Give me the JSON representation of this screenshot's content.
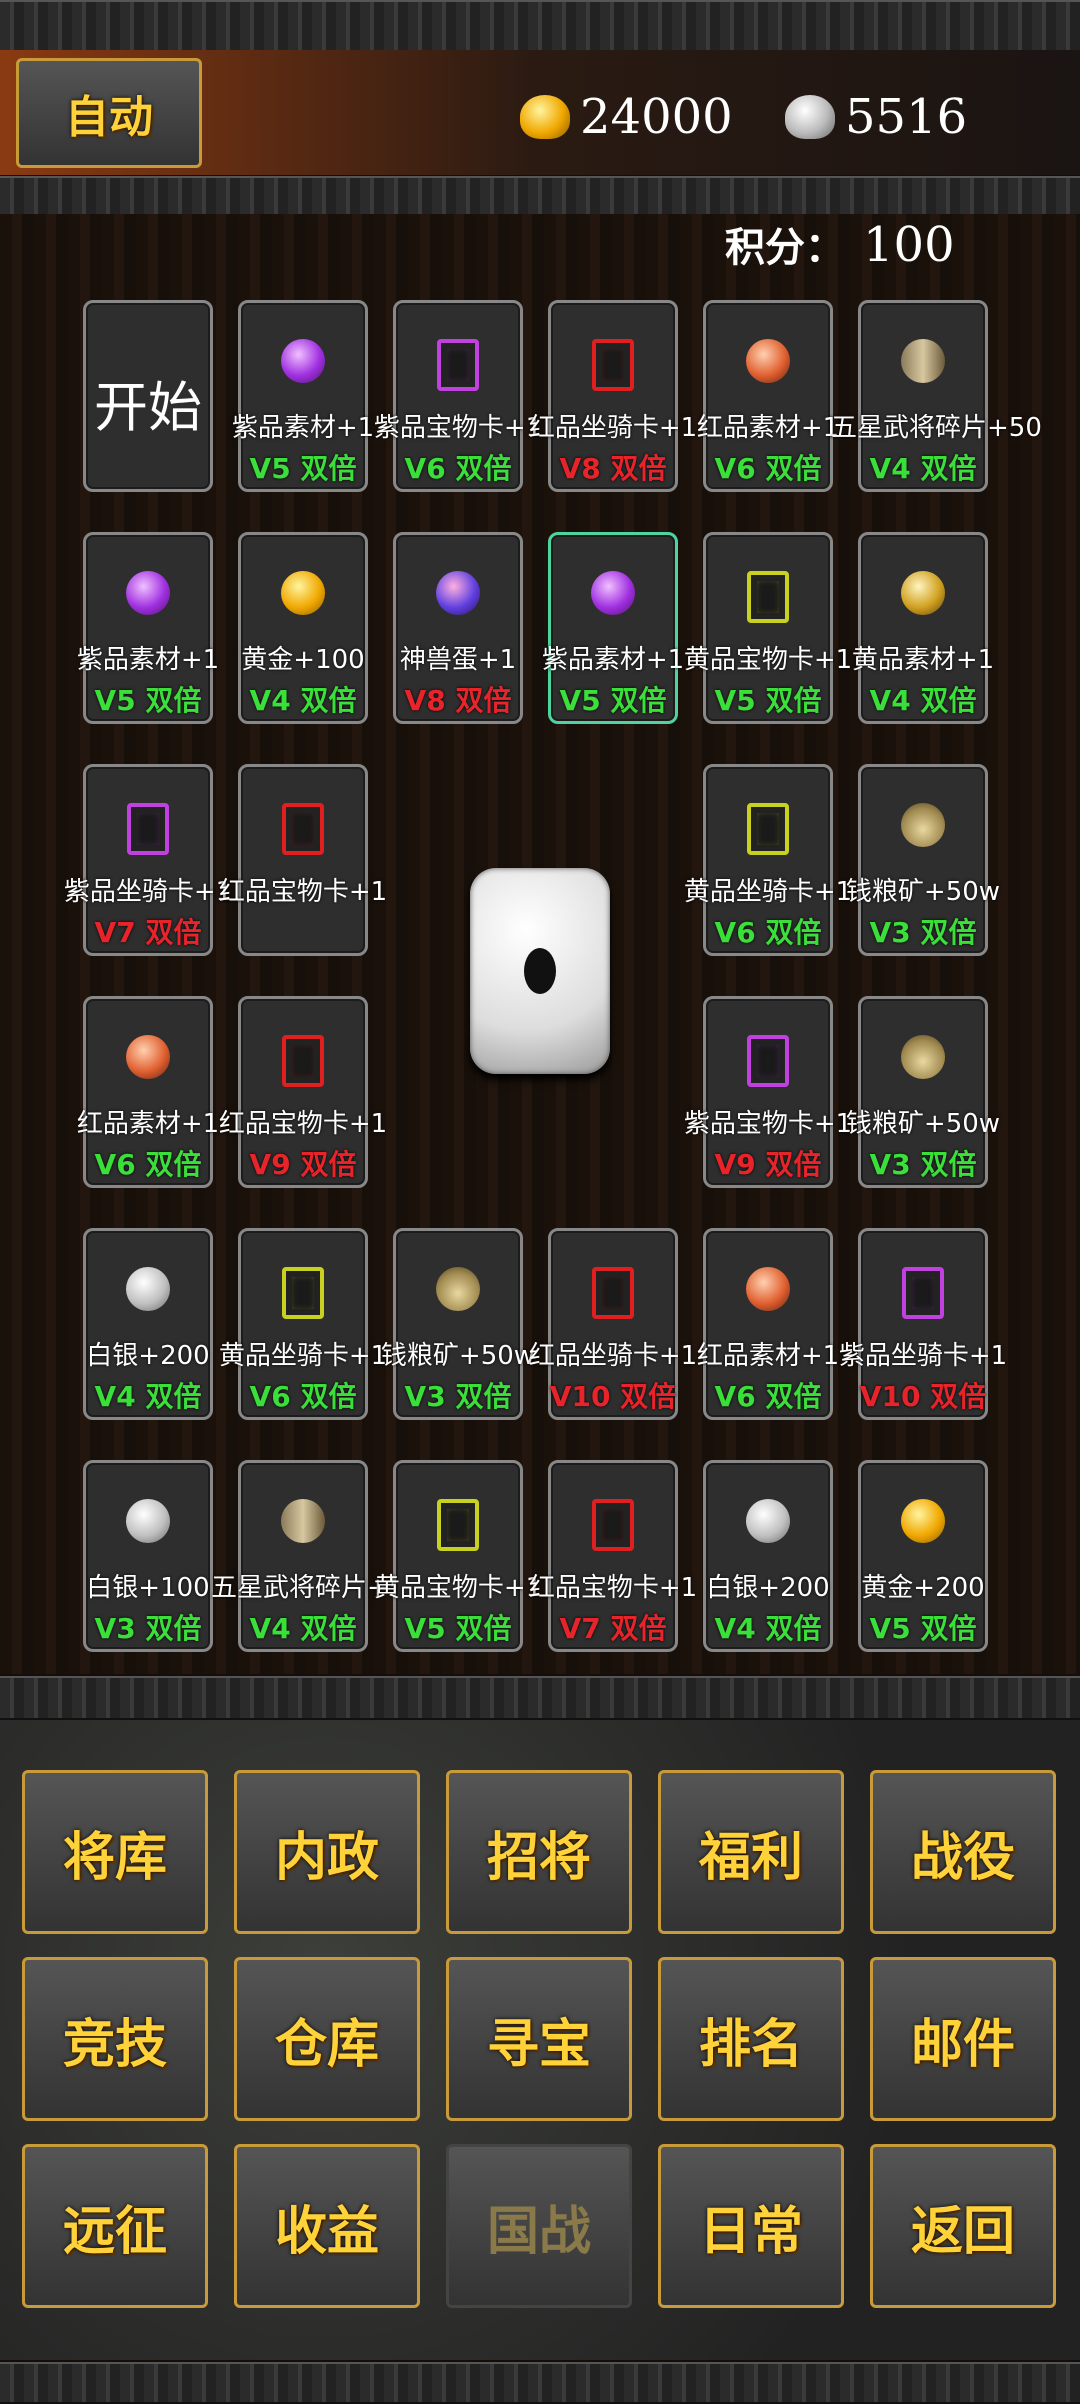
{
  "topbar": {
    "auto_label": "自动",
    "gold": "24000",
    "silver": "5516"
  },
  "score": {
    "label": "积分：",
    "value": "100"
  },
  "start_label": "开始",
  "colors": {
    "green": "#3adf3a",
    "red": "#e8242a",
    "gold_text": "#ffd23a",
    "selected_border": "#4fd3a0"
  },
  "tiles": [
    {
      "name": "紫品素材+1",
      "bonus": "V5 双倍",
      "bonus_color": "green",
      "icon": "purple-material-icon"
    },
    {
      "name": "紫品宝物卡+1",
      "bonus": "V6 双倍",
      "bonus_color": "green",
      "icon": "purple-treasure-card-icon"
    },
    {
      "name": "红品坐骑卡+1",
      "bonus": "V8 双倍",
      "bonus_color": "red",
      "icon": "red-mount-card-icon"
    },
    {
      "name": "红品素材+1",
      "bonus": "V6 双倍",
      "bonus_color": "green",
      "icon": "red-material-icon"
    },
    {
      "name": "五星武将碎片+50",
      "bonus": "V4 双倍",
      "bonus_color": "green",
      "icon": "general-fragment-icon"
    },
    {
      "name": "紫品素材+1",
      "bonus": "V5 双倍",
      "bonus_color": "green",
      "icon": "purple-material-icon"
    },
    {
      "name": "黄金+100",
      "bonus": "V4 双倍",
      "bonus_color": "green",
      "icon": "gold-ingot-icon"
    },
    {
      "name": "神兽蛋+1",
      "bonus": "V8 双倍",
      "bonus_color": "red",
      "icon": "beast-egg-icon"
    },
    {
      "name": "紫品素材+1",
      "bonus": "V5 双倍",
      "bonus_color": "green",
      "icon": "purple-material-icon",
      "selected": true
    },
    {
      "name": "黄品宝物卡+1",
      "bonus": "V5 双倍",
      "bonus_color": "green",
      "icon": "yellow-treasure-card-icon"
    },
    {
      "name": "黄品素材+1",
      "bonus": "V4 双倍",
      "bonus_color": "green",
      "icon": "yellow-material-icon"
    },
    {
      "name": "紫品坐骑卡+1",
      "bonus": "V7 双倍",
      "bonus_color": "red",
      "icon": "purple-mount-card-icon"
    },
    {
      "name": "红品宝物卡+1",
      "bonus": "",
      "bonus_color": "red",
      "icon": "red-treasure-card-icon"
    },
    {
      "name": "黄品坐骑卡+1",
      "bonus": "V6 双倍",
      "bonus_color": "green",
      "icon": "yellow-mount-card-icon"
    },
    {
      "name": "钱粮矿+50w",
      "bonus": "V3 双倍",
      "bonus_color": "green",
      "icon": "grain-money-icon"
    },
    {
      "name": "红品素材+1",
      "bonus": "V6 双倍",
      "bonus_color": "green",
      "icon": "red-material-icon"
    },
    {
      "name": "红品宝物卡+1",
      "bonus": "V9 双倍",
      "bonus_color": "red",
      "icon": "red-treasure-card-icon"
    },
    {
      "name": "紫品宝物卡+1",
      "bonus": "V9 双倍",
      "bonus_color": "red",
      "icon": "purple-treasure-card-icon"
    },
    {
      "name": "钱粮矿+50w",
      "bonus": "V3 双倍",
      "bonus_color": "green",
      "icon": "grain-money-icon"
    },
    {
      "name": "白银+200",
      "bonus": "V4 双倍",
      "bonus_color": "green",
      "icon": "silver-ingot-icon"
    },
    {
      "name": "黄品坐骑卡+1",
      "bonus": "V6 双倍",
      "bonus_color": "green",
      "icon": "yellow-mount-card-icon"
    },
    {
      "name": "钱粮矿+50w",
      "bonus": "V3 双倍",
      "bonus_color": "green",
      "icon": "grain-money-icon"
    },
    {
      "name": "红品坐骑卡+1",
      "bonus": "V10 双倍",
      "bonus_color": "red",
      "icon": "red-mount-card-icon"
    },
    {
      "name": "红品素材+1",
      "bonus": "V6 双倍",
      "bonus_color": "green",
      "icon": "red-material-icon"
    },
    {
      "name": "紫品坐骑卡+1",
      "bonus": "V10 双倍",
      "bonus_color": "red",
      "icon": "purple-mount-card-icon"
    },
    {
      "name": "白银+100",
      "bonus": "V3 双倍",
      "bonus_color": "green",
      "icon": "silver-ingot-icon"
    },
    {
      "name": "五星武将碎片+50",
      "bonus": "V4 双倍",
      "bonus_color": "green",
      "icon": "general-fragment-icon"
    },
    {
      "name": "黄品宝物卡+1",
      "bonus": "V5 双倍",
      "bonus_color": "green",
      "icon": "yellow-treasure-card-icon"
    },
    {
      "name": "红品宝物卡+1",
      "bonus": "V7 双倍",
      "bonus_color": "red",
      "icon": "red-treasure-card-icon"
    },
    {
      "name": "白银+200",
      "bonus": "V4 双倍",
      "bonus_color": "green",
      "icon": "silver-ingot-icon"
    },
    {
      "name": "黄金+200",
      "bonus": "V5 双倍",
      "bonus_color": "green",
      "icon": "gold-ingot-icon"
    }
  ],
  "menu": [
    {
      "label": "将库",
      "key": "generals"
    },
    {
      "label": "内政",
      "key": "domestic"
    },
    {
      "label": "招将",
      "key": "recruit"
    },
    {
      "label": "福利",
      "key": "welfare"
    },
    {
      "label": "战役",
      "key": "campaign"
    },
    {
      "label": "竞技",
      "key": "arena"
    },
    {
      "label": "仓库",
      "key": "warehouse"
    },
    {
      "label": "寻宝",
      "key": "treasure-hunt"
    },
    {
      "label": "排名",
      "key": "ranking"
    },
    {
      "label": "邮件",
      "key": "mail"
    },
    {
      "label": "远征",
      "key": "expedition"
    },
    {
      "label": "收益",
      "key": "income"
    },
    {
      "label": "国战",
      "key": "nation-war",
      "dimmed": true
    },
    {
      "label": "日常",
      "key": "daily"
    },
    {
      "label": "返回",
      "key": "back"
    }
  ]
}
